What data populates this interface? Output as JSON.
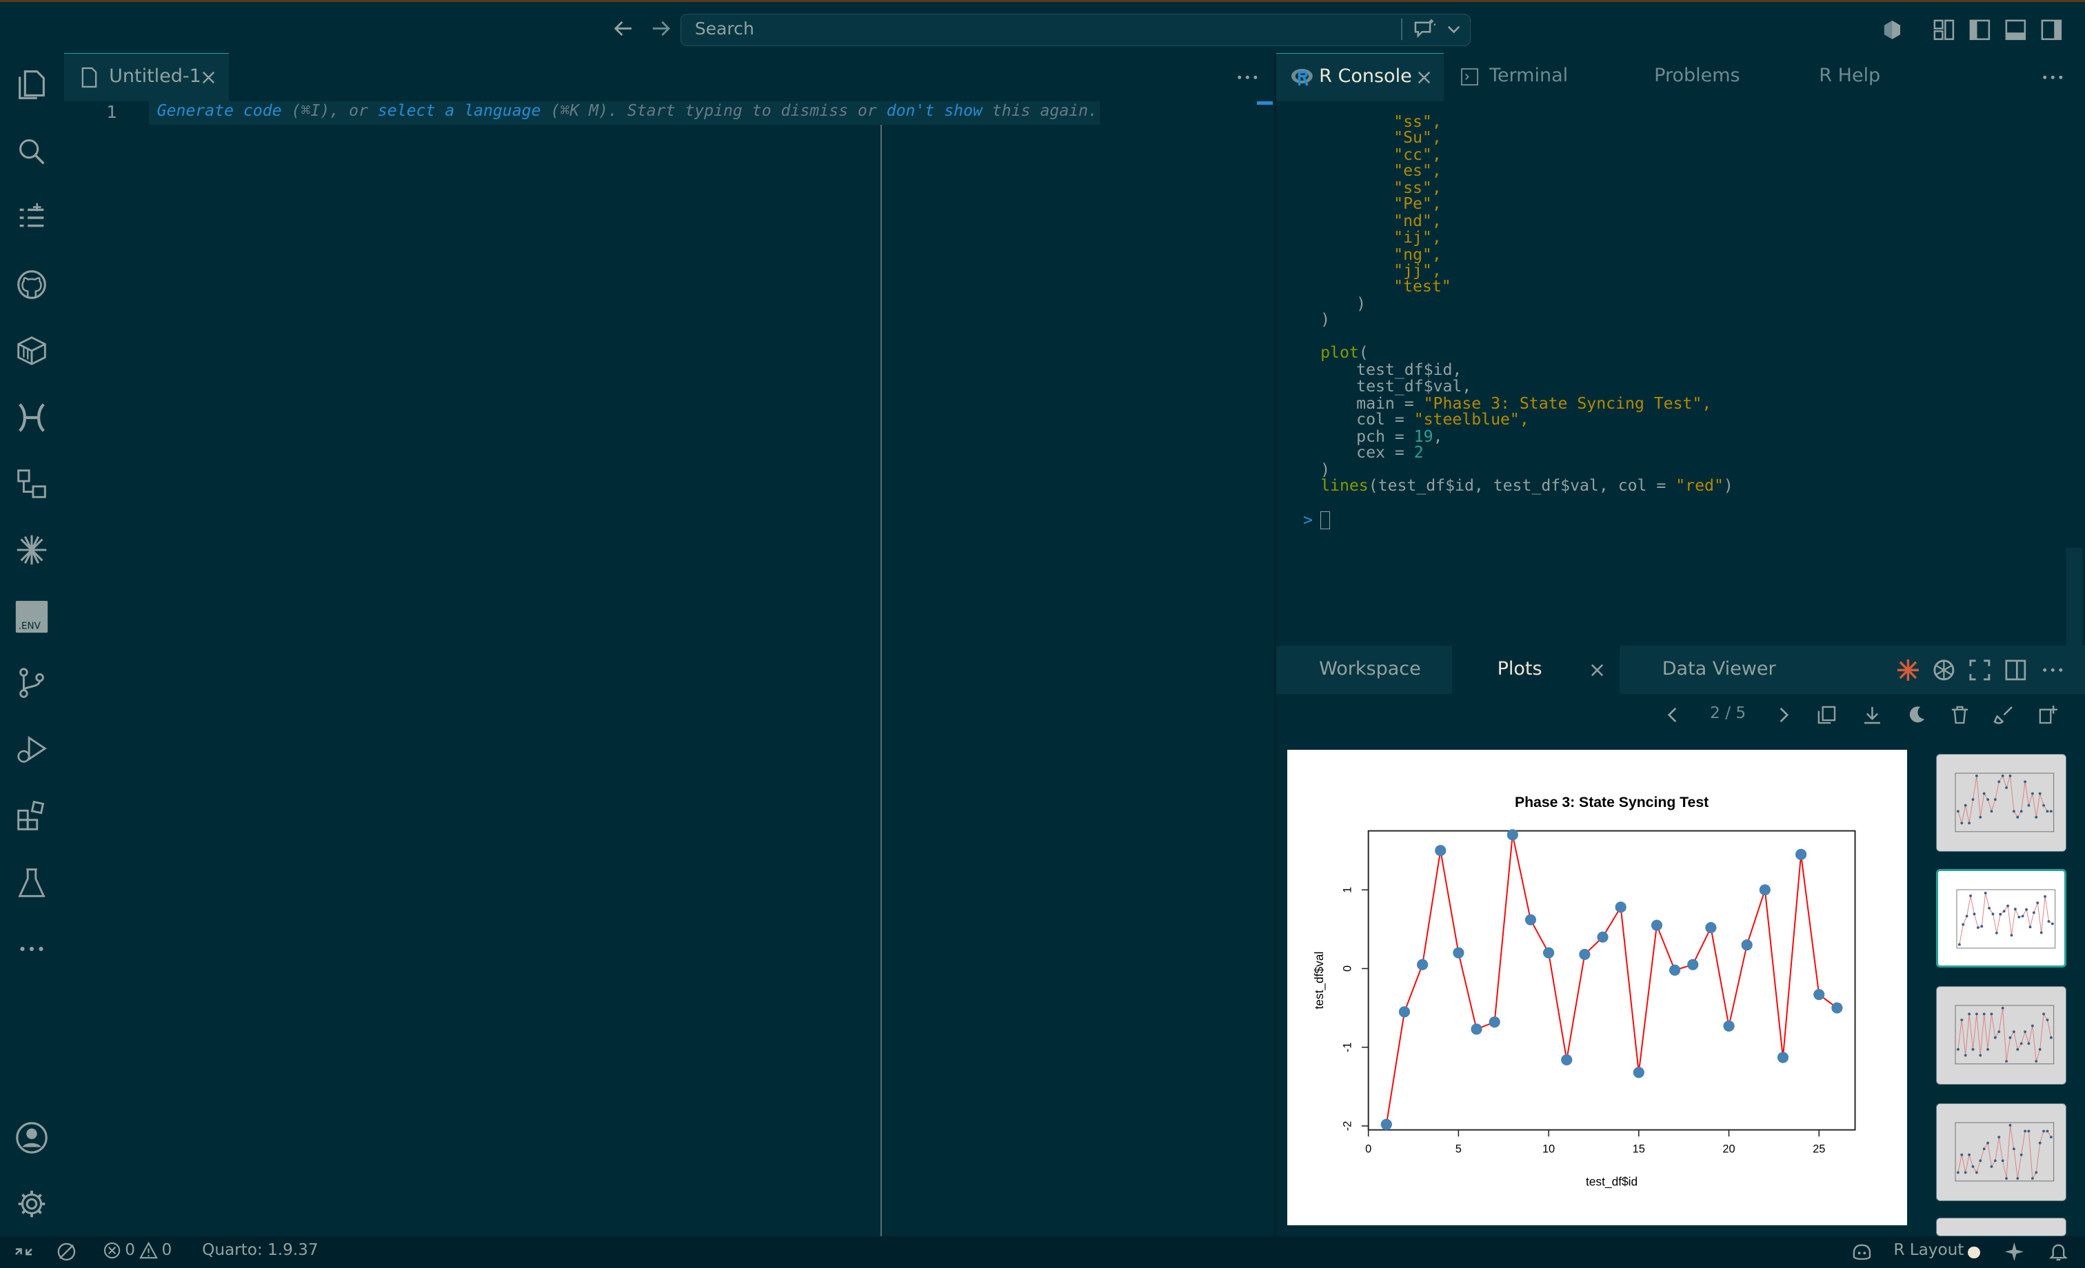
{
  "search": {
    "placeholder": "Search"
  },
  "editor": {
    "tab_label": "Untitled-1",
    "line_number": "1",
    "hint": {
      "generate": "Generate code",
      "shortcut1": " (⌘I), or ",
      "select": "select a language",
      "shortcut2": " (⌘K M). Start typing to dismiss or ",
      "dont": "don't show",
      "rest": " this again."
    }
  },
  "console_tabs": [
    "R Console",
    "Terminal",
    "Problems",
    "R Help"
  ],
  "console": {
    "strings": [
      "\"ss\",",
      "\"Su\",",
      "\"cc\",",
      "\"es\",",
      "\"ss\",",
      "\"Pe\",",
      "\"nd\",",
      "\"ij\",",
      "\"ng\",",
      "\"jj\",",
      "\"test\""
    ],
    "close_inner": ")",
    "close_outer": ")",
    "plot_fn": "plot",
    "plot_open": "(",
    "arg_id": "test_df$id,",
    "arg_val": "test_df$val,",
    "arg_main_key": "main = ",
    "arg_main_val": "\"Phase 3: State Syncing Test\",",
    "arg_col_key": "col = ",
    "arg_col_val": "\"steelblue\",",
    "arg_pch_key": "pch = ",
    "arg_pch_val": "19",
    "arg_pch_comma": ",",
    "arg_cex_key": "cex = ",
    "arg_cex_val": "2",
    "plot_close": ")",
    "lines_fn": "lines",
    "lines_args": "(test_df$id, test_df$val, col = ",
    "lines_col": "\"red\"",
    "lines_close": ")",
    "prompt": ">"
  },
  "plots_tabs": [
    "Workspace",
    "Plots",
    "Data Viewer"
  ],
  "plots_nav": {
    "page": "2 / 5"
  },
  "status": {
    "errors": "0",
    "warnings": "0",
    "quarto": "Quarto: 1.9.37",
    "layout": "R Layout"
  },
  "colors": {
    "background": "#002b36",
    "accent": "#2aa198",
    "point": "#4682b4",
    "line": "#ff0000",
    "string": "#b58900",
    "function": "#859900"
  },
  "chart_data": {
    "type": "scatter",
    "title": "Phase 3: State Syncing Test",
    "xlabel": "test_df$id",
    "ylabel": "test_df$val",
    "x": [
      1,
      2,
      3,
      4,
      5,
      6,
      7,
      8,
      9,
      10,
      11,
      12,
      13,
      14,
      15,
      16,
      17,
      18,
      19,
      20,
      21,
      22,
      23,
      24,
      25,
      26
    ],
    "y": [
      -1.98,
      -0.55,
      0.05,
      1.5,
      0.2,
      -0.77,
      -0.68,
      1.7,
      0.62,
      0.2,
      -1.16,
      0.18,
      0.4,
      0.78,
      -1.32,
      0.55,
      -0.02,
      0.05,
      0.52,
      -0.73,
      0.3,
      1.0,
      -1.13,
      1.45,
      -0.33,
      -0.5
    ],
    "xticks": [
      "0",
      "5",
      "10",
      "15",
      "20",
      "25"
    ],
    "yticks": [
      "-2",
      "-1",
      "0",
      "1"
    ],
    "xlim": [
      0,
      27
    ],
    "ylim": [
      -2.05,
      1.75
    ],
    "point_color": "#4682b4",
    "line_color": "#ff0000"
  }
}
